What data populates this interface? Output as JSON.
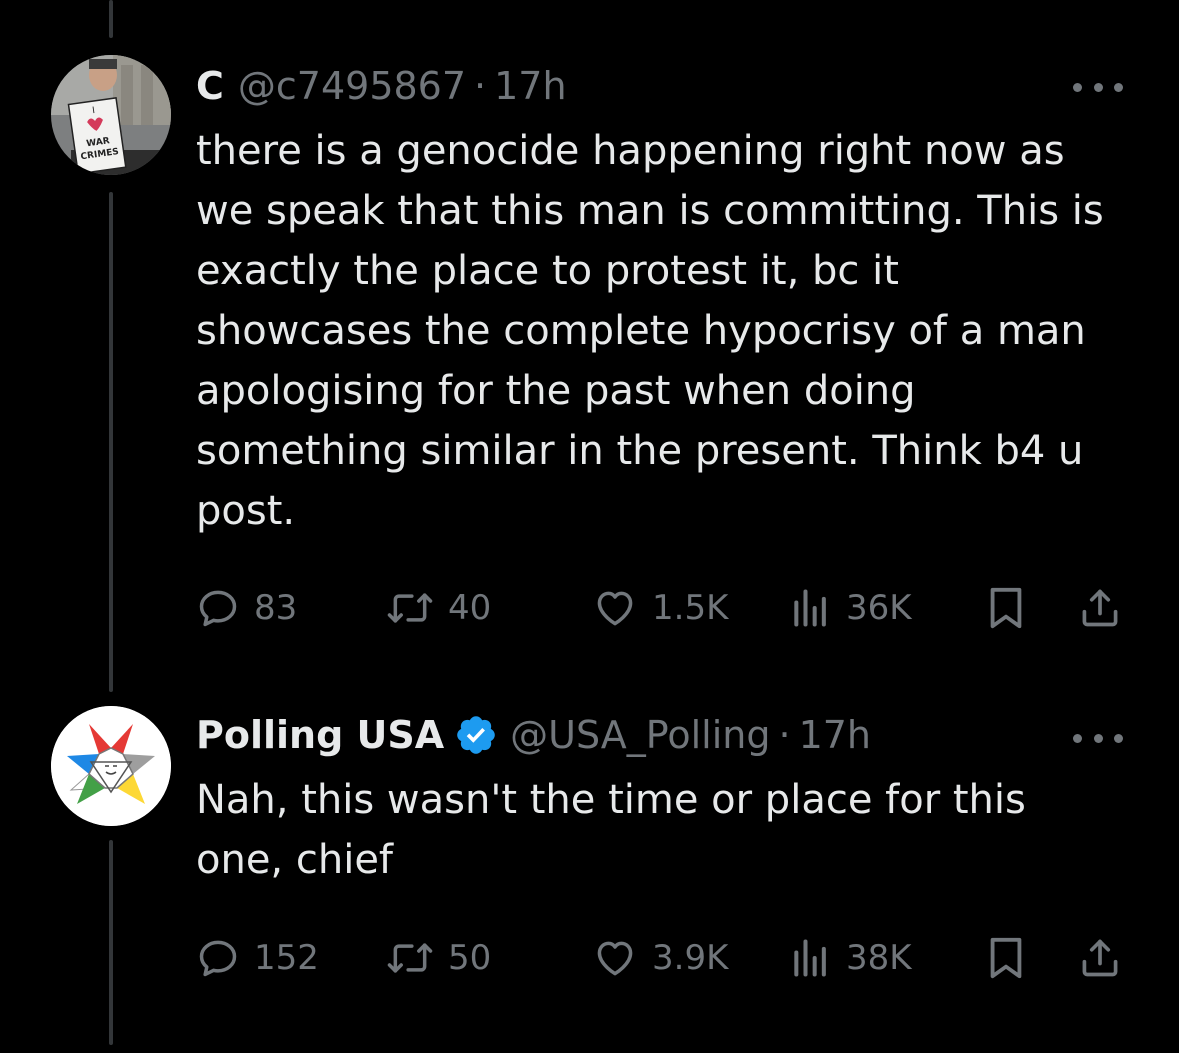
{
  "tweets": [
    {
      "display_name": "C",
      "handle": "@c7495867",
      "separator": "·",
      "time": "17h",
      "verified": false,
      "avatar_sign_text": "WAR CRIMES",
      "text": "there is a genocide happening right now as\nwe speak that this man is committing. This is\nexactly the place to protest it, bc it\nshowcases the complete hypocrisy of a man\napologising for the past when doing\nsomething similar in the present. Think b4 u\npost.",
      "replies": "83",
      "reposts": "40",
      "likes": "1.5K",
      "views": "36K"
    },
    {
      "display_name": "Polling USA",
      "handle": "@USA_Polling",
      "separator": "·",
      "time": "17h",
      "verified": true,
      "text": "Nah, this wasn't the time or place for this\none, chief",
      "replies": "152",
      "reposts": "50",
      "likes": "3.9K",
      "views": "38K"
    }
  ],
  "colors": {
    "background": "#000000",
    "primary_text": "#e7e9ea",
    "secondary_text": "#71767b",
    "verified_badge": "#1d9bf0",
    "thread_line": "#333639"
  },
  "icons": [
    "reply-icon",
    "repost-icon",
    "like-icon",
    "views-icon",
    "bookmark-icon",
    "share-icon",
    "more-icon",
    "verified-badge-icon"
  ]
}
